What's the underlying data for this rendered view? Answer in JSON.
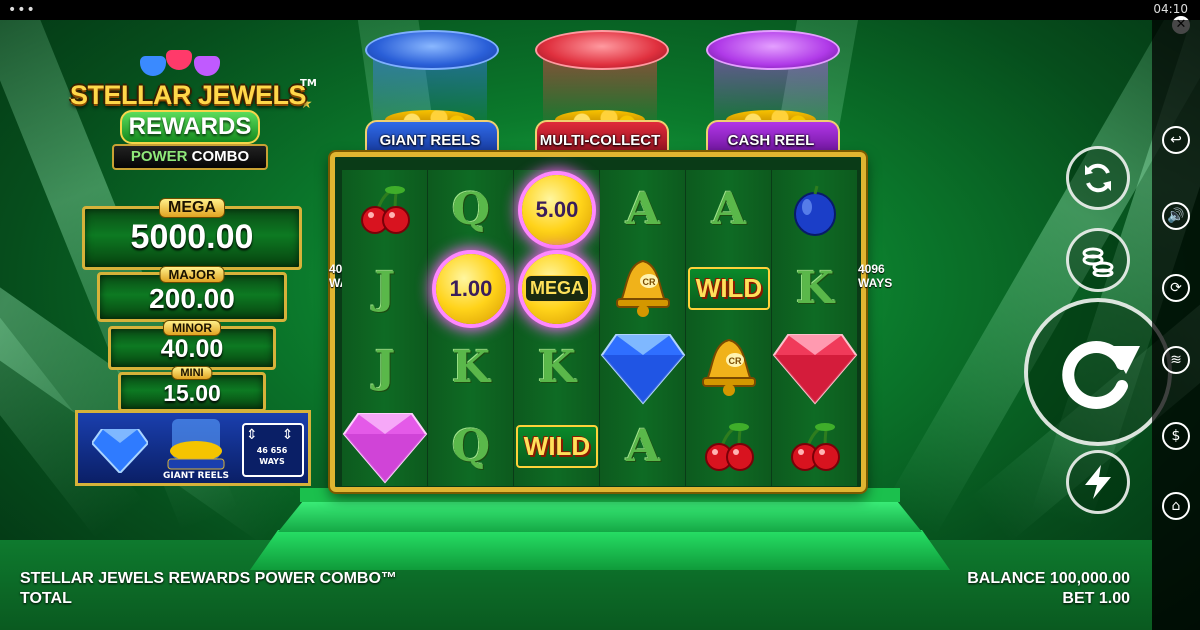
{
  "status": {
    "time": "04:10",
    "menu_dots": "•••",
    "close": "✕"
  },
  "logo": {
    "line1": "STELLAR JEWELS",
    "tm": "TM",
    "line2": "REWARDS",
    "line3a": "POWER",
    "line3b": "COMBO"
  },
  "jackpots": [
    {
      "label": "MEGA",
      "value": "5000.00"
    },
    {
      "label": "MAJOR",
      "value": "200.00"
    },
    {
      "label": "MINOR",
      "value": "40.00"
    },
    {
      "label": "MINI",
      "value": "15.00"
    }
  ],
  "feature_box": {
    "giant_reels": "GIANT REELS",
    "ways": "46 656 WAYS"
  },
  "tubes": [
    {
      "label": "GIANT REELS",
      "color": "#3a7bff"
    },
    {
      "label": "MULTI-COLLECT",
      "color": "#ff3a4a"
    },
    {
      "label": "CASH REEL",
      "color": "#c04aff"
    }
  ],
  "ways_side": "4096 WAYS",
  "reels": [
    [
      "cherry",
      "J",
      "J",
      "diamond-pink"
    ],
    [
      "Q",
      "coin:1.00",
      "K",
      "Q"
    ],
    [
      "coin:5.00",
      "coin:MEGA",
      "K",
      "wild"
    ],
    [
      "A",
      "bell",
      "diamond-blue",
      "A"
    ],
    [
      "A",
      "wild",
      "bell",
      "cherry"
    ],
    [
      "plum",
      "K",
      "diamond-red",
      "cherry"
    ]
  ],
  "wild_text": "WILD",
  "bell_text": "CR",
  "footer": {
    "game_name": "STELLAR JEWELS REWARDS POWER COMBO™",
    "total_label": "TOTAL",
    "balance": "BALANCE 100,000.00",
    "bet": "BET 1.00"
  },
  "sidebar_icons": [
    "back-icon",
    "sound-icon",
    "autoplay-icon",
    "coins-icon",
    "paytable-icon",
    "home-icon"
  ],
  "controls": [
    "autoplay-icon",
    "bet-coins-icon",
    "spin-icon",
    "turbo-icon"
  ]
}
